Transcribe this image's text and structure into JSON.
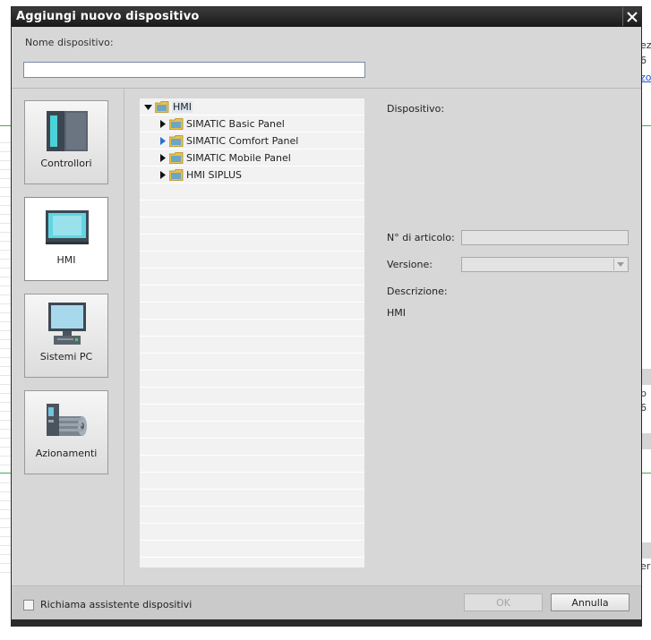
{
  "dialog": {
    "title": "Aggiungi nuovo dispositivo",
    "name_label": "Nome dispositivo:",
    "name_value": ""
  },
  "categories": [
    {
      "label": "Controllori",
      "icon": "plc-controller-icon"
    },
    {
      "label": "HMI",
      "icon": "hmi-panel-icon",
      "selected": true
    },
    {
      "label": "Sistemi PC",
      "icon": "pc-system-icon"
    },
    {
      "label": "Azionamenti",
      "icon": "drive-motor-icon"
    }
  ],
  "tree": {
    "root": "HMI",
    "children": [
      "SIMATIC Basic Panel",
      "SIMATIC Comfort Panel",
      "SIMATIC Mobile Panel",
      "HMI SIPLUS"
    ]
  },
  "info": {
    "device_label": "Dispositivo:",
    "article_label": "N° di articolo:",
    "version_label": "Versione:",
    "description_label": "Descrizione:",
    "description_value": "HMI"
  },
  "footer": {
    "wizard_label": "Richiama assistente dispositivi",
    "ok_label": "OK",
    "cancel_label": "Annulla"
  },
  "background": {
    "fragments": [
      "ez",
      "6",
      "zo",
      "p",
      "6",
      "er"
    ]
  },
  "colors": {
    "title_bar": "#1f1f1f",
    "dialog_bg": "#d7d7d7",
    "tree_selection": "#dde6f2",
    "accent_green": "#44aa55",
    "folder_yellow": "#e8c04a"
  }
}
